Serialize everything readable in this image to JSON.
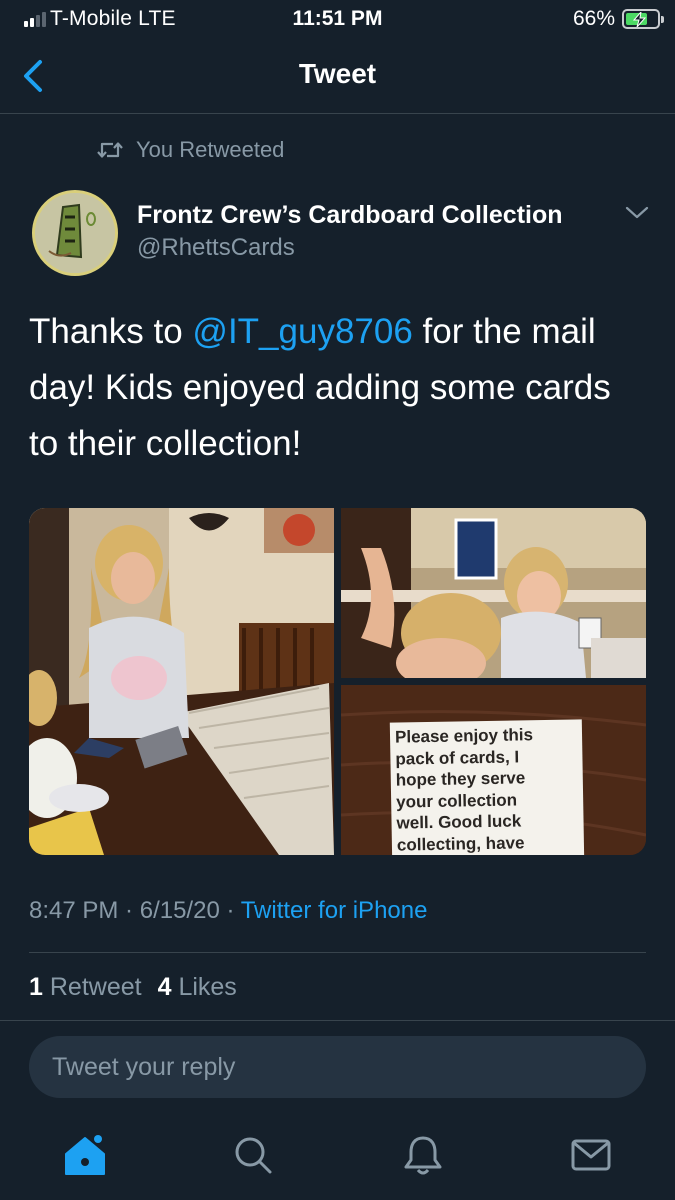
{
  "status_bar": {
    "carrier": "T-Mobile  LTE",
    "time": "11:51 PM",
    "battery_percent": "66%",
    "signal_bars": 2,
    "battery_level": 0.66
  },
  "nav": {
    "title": "Tweet"
  },
  "retweet_label": "You Retweeted",
  "author": {
    "name": "Frontz Crew’s Cardboard Collection",
    "handle": "@RhettsCards"
  },
  "tweet": {
    "text_before": "Thanks to ",
    "mention": "@IT_guy8706",
    "text_after": " for the mail day! Kids enjoyed adding some cards to their collection!"
  },
  "media": {
    "note_lines": [
      "Please enjoy this",
      "pack of cards, I",
      "hope they serve",
      "your collection",
      "well. Good luck",
      "collecting, have"
    ]
  },
  "meta": {
    "time": "8:47 PM",
    "date": "6/15/20",
    "separator": " · ",
    "app": "Twitter for iPhone"
  },
  "stats": {
    "retweets": "1",
    "retweets_label": "Retweet",
    "likes": "4",
    "likes_label": "Likes"
  },
  "reply": {
    "placeholder": "Tweet your reply"
  },
  "colors": {
    "background": "#15202b",
    "accent": "#1da1f2",
    "muted": "#8899a6",
    "divider": "#38444d",
    "input_bg": "#253341"
  },
  "tab_icons": [
    "home-icon",
    "search-icon",
    "notifications-icon",
    "messages-icon"
  ]
}
